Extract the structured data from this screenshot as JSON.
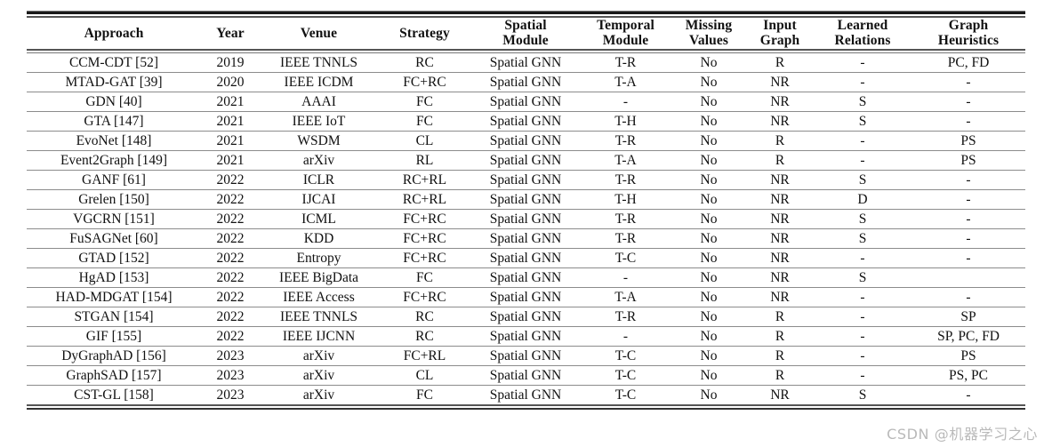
{
  "table": {
    "columns": [
      {
        "id": "approach",
        "label_lines": [
          "Approach"
        ]
      },
      {
        "id": "year",
        "label_lines": [
          "Year"
        ]
      },
      {
        "id": "venue",
        "label_lines": [
          "Venue"
        ]
      },
      {
        "id": "strategy",
        "label_lines": [
          "Strategy"
        ]
      },
      {
        "id": "spatial",
        "label_lines": [
          "Spatial",
          "Module"
        ]
      },
      {
        "id": "temporal",
        "label_lines": [
          "Temporal",
          "Module"
        ]
      },
      {
        "id": "missing",
        "label_lines": [
          "Missing",
          "Values"
        ]
      },
      {
        "id": "input",
        "label_lines": [
          "Input",
          "Graph"
        ]
      },
      {
        "id": "learned",
        "label_lines": [
          "Learned",
          "Relations"
        ]
      },
      {
        "id": "heuristics",
        "label_lines": [
          "Graph",
          "Heuristics"
        ]
      }
    ],
    "rows": [
      {
        "approach": "CCM-CDT [52]",
        "year": "2019",
        "venue": "IEEE TNNLS",
        "strategy": "RC",
        "spatial": "Spatial GNN",
        "temporal": "T-R",
        "missing": "No",
        "input": "R",
        "learned": "-",
        "heuristics": "PC, FD"
      },
      {
        "approach": "MTAD-GAT [39]",
        "year": "2020",
        "venue": "IEEE ICDM",
        "strategy": "FC+RC",
        "spatial": "Spatial GNN",
        "temporal": "T-A",
        "missing": "No",
        "input": "NR",
        "learned": "-",
        "heuristics": "-"
      },
      {
        "approach": "GDN [40]",
        "year": "2021",
        "venue": "AAAI",
        "strategy": "FC",
        "spatial": "Spatial GNN",
        "temporal": "-",
        "missing": "No",
        "input": "NR",
        "learned": "S",
        "heuristics": "-"
      },
      {
        "approach": "GTA [147]",
        "year": "2021",
        "venue": "IEEE IoT",
        "strategy": "FC",
        "spatial": "Spatial GNN",
        "temporal": "T-H",
        "missing": "No",
        "input": "NR",
        "learned": "S",
        "heuristics": "-"
      },
      {
        "approach": "EvoNet [148]",
        "year": "2021",
        "venue": "WSDM",
        "strategy": "CL",
        "spatial": "Spatial GNN",
        "temporal": "T-R",
        "missing": "No",
        "input": "R",
        "learned": "-",
        "heuristics": "PS"
      },
      {
        "approach": "Event2Graph [149]",
        "year": "2021",
        "venue": "arXiv",
        "strategy": "RL",
        "spatial": "Spatial GNN",
        "temporal": "T-A",
        "missing": "No",
        "input": "R",
        "learned": "-",
        "heuristics": "PS"
      },
      {
        "approach": "GANF [61]",
        "year": "2022",
        "venue": "ICLR",
        "strategy": "RC+RL",
        "spatial": "Spatial GNN",
        "temporal": "T-R",
        "missing": "No",
        "input": "NR",
        "learned": "S",
        "heuristics": "-"
      },
      {
        "approach": "Grelen [150]",
        "year": "2022",
        "venue": "IJCAI",
        "strategy": "RC+RL",
        "spatial": "Spatial GNN",
        "temporal": "T-H",
        "missing": "No",
        "input": "NR",
        "learned": "D",
        "heuristics": "-"
      },
      {
        "approach": "VGCRN [151]",
        "year": "2022",
        "venue": "ICML",
        "strategy": "FC+RC",
        "spatial": "Spatial GNN",
        "temporal": "T-R",
        "missing": "No",
        "input": "NR",
        "learned": "S",
        "heuristics": "-"
      },
      {
        "approach": "FuSAGNet [60]",
        "year": "2022",
        "venue": "KDD",
        "strategy": "FC+RC",
        "spatial": "Spatial GNN",
        "temporal": "T-R",
        "missing": "No",
        "input": "NR",
        "learned": "S",
        "heuristics": "-"
      },
      {
        "approach": "GTAD [152]",
        "year": "2022",
        "venue": "Entropy",
        "strategy": "FC+RC",
        "spatial": "Spatial GNN",
        "temporal": "T-C",
        "missing": "No",
        "input": "NR",
        "learned": "-",
        "heuristics": "-"
      },
      {
        "approach": "HgAD [153]",
        "year": "2022",
        "venue": "IEEE BigData",
        "strategy": "FC",
        "spatial": "Spatial GNN",
        "temporal": "-",
        "missing": "No",
        "input": "NR",
        "learned": "S",
        "heuristics": ""
      },
      {
        "approach": "HAD-MDGAT [154]",
        "year": "2022",
        "venue": "IEEE Access",
        "strategy": "FC+RC",
        "spatial": "Spatial GNN",
        "temporal": "T-A",
        "missing": "No",
        "input": "NR",
        "learned": "-",
        "heuristics": "-"
      },
      {
        "approach": "STGAN [154]",
        "year": "2022",
        "venue": "IEEE TNNLS",
        "strategy": "RC",
        "spatial": "Spatial GNN",
        "temporal": "T-R",
        "missing": "No",
        "input": "R",
        "learned": "-",
        "heuristics": "SP"
      },
      {
        "approach": "GIF [155]",
        "year": "2022",
        "venue": "IEEE IJCNN",
        "strategy": "RC",
        "spatial": "Spatial GNN",
        "temporal": "-",
        "missing": "No",
        "input": "R",
        "learned": "-",
        "heuristics": "SP, PC, FD"
      },
      {
        "approach": "DyGraphAD [156]",
        "year": "2023",
        "venue": "arXiv",
        "strategy": "FC+RL",
        "spatial": "Spatial GNN",
        "temporal": "T-C",
        "missing": "No",
        "input": "R",
        "learned": "-",
        "heuristics": "PS"
      },
      {
        "approach": "GraphSAD [157]",
        "year": "2023",
        "venue": "arXiv",
        "strategy": "CL",
        "spatial": "Spatial GNN",
        "temporal": "T-C",
        "missing": "No",
        "input": "R",
        "learned": "-",
        "heuristics": "PS, PC"
      },
      {
        "approach": "CST-GL [158]",
        "year": "2023",
        "venue": "arXiv",
        "strategy": "FC",
        "spatial": "Spatial GNN",
        "temporal": "T-C",
        "missing": "No",
        "input": "NR",
        "learned": "S",
        "heuristics": "-"
      }
    ]
  },
  "watermark": {
    "text": "CSDN @机器学习之心"
  }
}
